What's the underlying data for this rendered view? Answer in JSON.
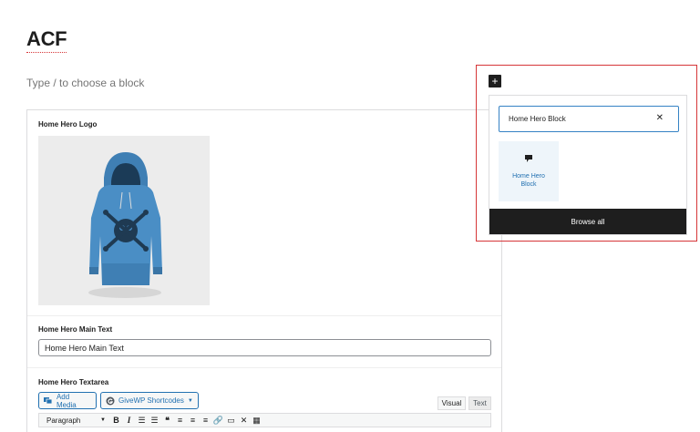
{
  "page": {
    "title": "ACF",
    "placeholder": "Type / to choose a block"
  },
  "acf_block": {
    "logo_label": "Home Hero Logo",
    "logo_image": "hoodie-image",
    "main_text_label": "Home Hero Main Text",
    "main_text_value": "Home Hero Main Text",
    "textarea_label": "Home Hero Textarea",
    "add_media_label": "Add Media",
    "givewp_label": "GiveWP Shortcodes",
    "tab_visual": "Visual",
    "tab_text": "Text",
    "format_select": "Paragraph",
    "toolbar_icons": [
      "bold-icon",
      "italic-icon",
      "bullet-list-icon",
      "numbered-list-icon",
      "blockquote-icon",
      "align-left-icon",
      "align-center-icon",
      "align-right-icon",
      "link-icon",
      "read-more-icon",
      "fullscreen-icon",
      "toolbar-toggle-icon"
    ]
  },
  "inserter": {
    "search_value": "Home Hero Block",
    "result_label": "Home Hero Block",
    "browse_all_label": "Browse all"
  },
  "colors": {
    "accent": "#2271b1",
    "highlight": "#d63638",
    "dark": "#1e1e1e"
  }
}
